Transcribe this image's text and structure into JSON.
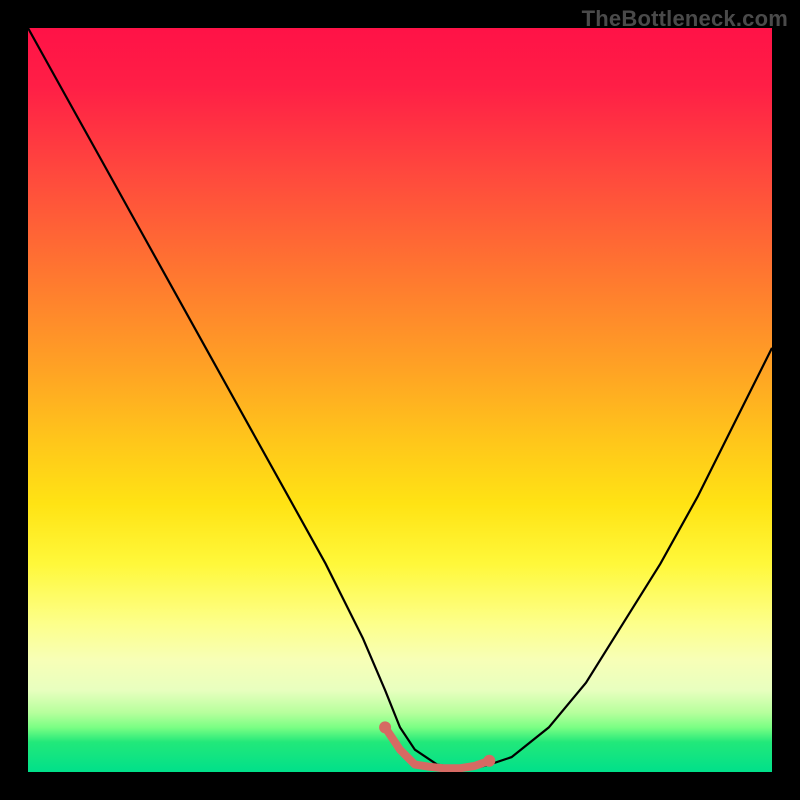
{
  "watermark": "TheBottleneck.com",
  "chart_data": {
    "type": "line",
    "title": "",
    "xlabel": "",
    "ylabel": "",
    "xlim": [
      0,
      100
    ],
    "ylim": [
      0,
      100
    ],
    "grid": false,
    "legend": false,
    "gradient_stops": [
      {
        "pct": 0,
        "color": "#ff1247"
      },
      {
        "pct": 8,
        "color": "#ff1f46"
      },
      {
        "pct": 20,
        "color": "#ff4a3d"
      },
      {
        "pct": 34,
        "color": "#ff7a2f"
      },
      {
        "pct": 46,
        "color": "#ffa324"
      },
      {
        "pct": 56,
        "color": "#ffc81a"
      },
      {
        "pct": 64,
        "color": "#ffe314"
      },
      {
        "pct": 72,
        "color": "#fff83a"
      },
      {
        "pct": 80,
        "color": "#fdff8a"
      },
      {
        "pct": 85,
        "color": "#f7ffb7"
      },
      {
        "pct": 89,
        "color": "#e8ffbf"
      },
      {
        "pct": 92,
        "color": "#b7ff9d"
      },
      {
        "pct": 94,
        "color": "#7bff84"
      },
      {
        "pct": 96,
        "color": "#22e87a"
      },
      {
        "pct": 100,
        "color": "#00e08a"
      }
    ],
    "series": [
      {
        "name": "bottleneck-curve",
        "color": "#000000",
        "x": [
          0,
          5,
          10,
          15,
          20,
          25,
          30,
          35,
          40,
          45,
          48,
          50,
          52,
          55,
          58,
          60,
          62,
          65,
          70,
          75,
          80,
          85,
          90,
          95,
          100
        ],
        "y": [
          100,
          91,
          82,
          73,
          64,
          55,
          46,
          37,
          28,
          18,
          11,
          6,
          3,
          1,
          0.5,
          0.5,
          1,
          2,
          6,
          12,
          20,
          28,
          37,
          47,
          57
        ]
      },
      {
        "name": "sweet-spot-marker",
        "color": "#d66a63",
        "x": [
          48,
          50,
          52,
          54,
          56,
          58,
          60,
          62
        ],
        "y": [
          6,
          3,
          1,
          0.7,
          0.5,
          0.5,
          0.8,
          1.5
        ]
      }
    ],
    "annotations": []
  }
}
